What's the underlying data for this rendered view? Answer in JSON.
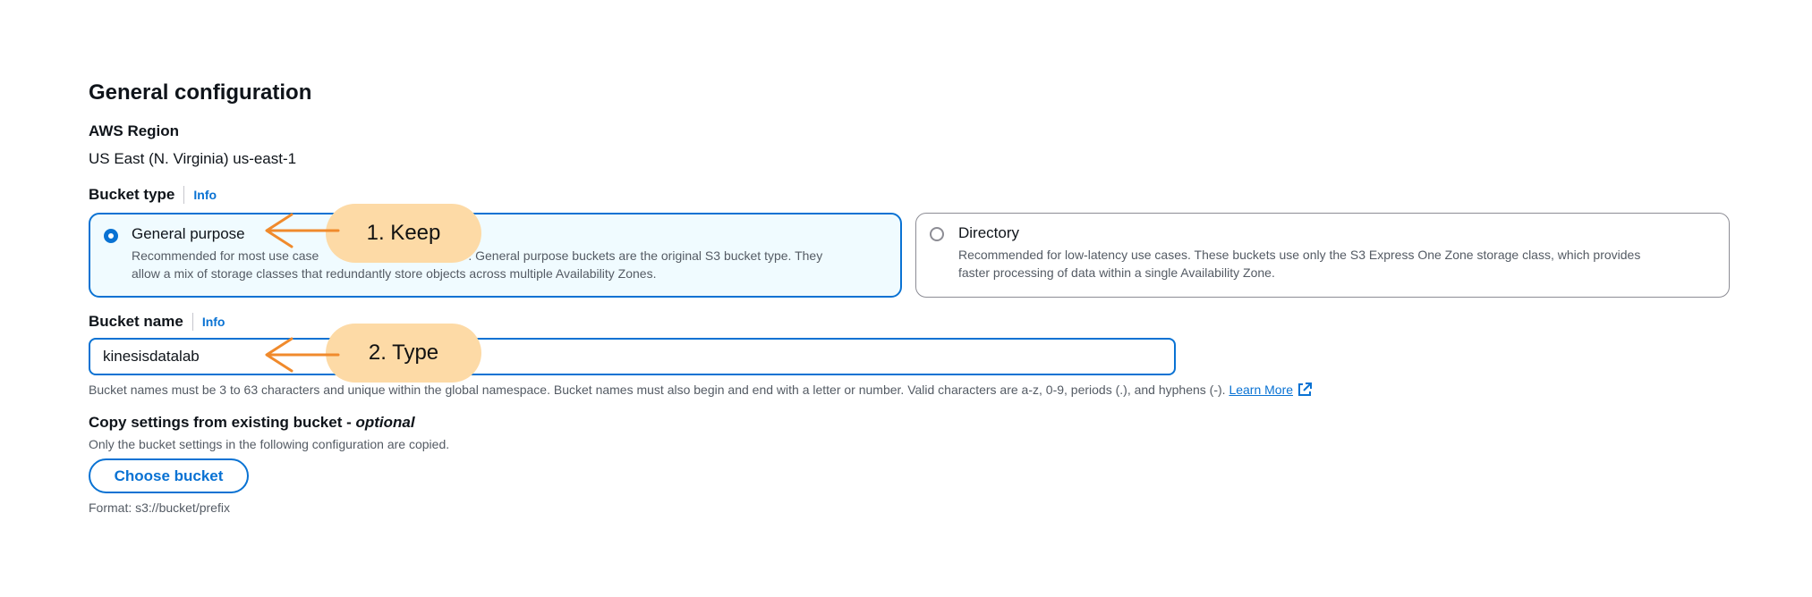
{
  "section": {
    "title": "General configuration"
  },
  "region": {
    "label": "AWS Region",
    "value": "US East (N. Virginia) us-east-1"
  },
  "bucket_type": {
    "label": "Bucket type",
    "info": "Info",
    "options": [
      {
        "title": "General purpose",
        "desc_line1_a": "Recommended for most use case",
        "desc_line1_b": ". General purpose buckets are the original S3 bucket type. They",
        "desc_line2": "allow a mix of storage classes that redundantly store objects across multiple Availability Zones.",
        "selected": true
      },
      {
        "title": "Directory",
        "desc_line1": "Recommended for low-latency use cases. These buckets use only the S3 Express One Zone storage class, which provides",
        "desc_line2": "faster processing of data within a single Availability Zone.",
        "selected": false
      }
    ]
  },
  "bucket_name": {
    "label": "Bucket name",
    "info": "Info",
    "value": "kinesisdatalab",
    "hint_a": "Bucket names must be 3 to 63 characters ",
    "hint_b": "and unique within the global namespace. Bucket names must also begin and end with a letter or number. Valid characters are a-z, 0-9, periods (.), and hyphens (-).",
    "learn_more": "Learn More"
  },
  "copy_settings": {
    "label": "Copy settings from existing bucket - ",
    "optional": "optional",
    "desc": "Only the bucket settings in the following configuration are copied.",
    "button": "Choose bucket",
    "format": "Format: s3://bucket/prefix"
  },
  "annotations": [
    {
      "text": "1. Keep"
    },
    {
      "text": "2. Type"
    }
  ],
  "colors": {
    "accent": "#0972d3",
    "callout": "#fddaa6",
    "arrow": "#f08a2c"
  }
}
